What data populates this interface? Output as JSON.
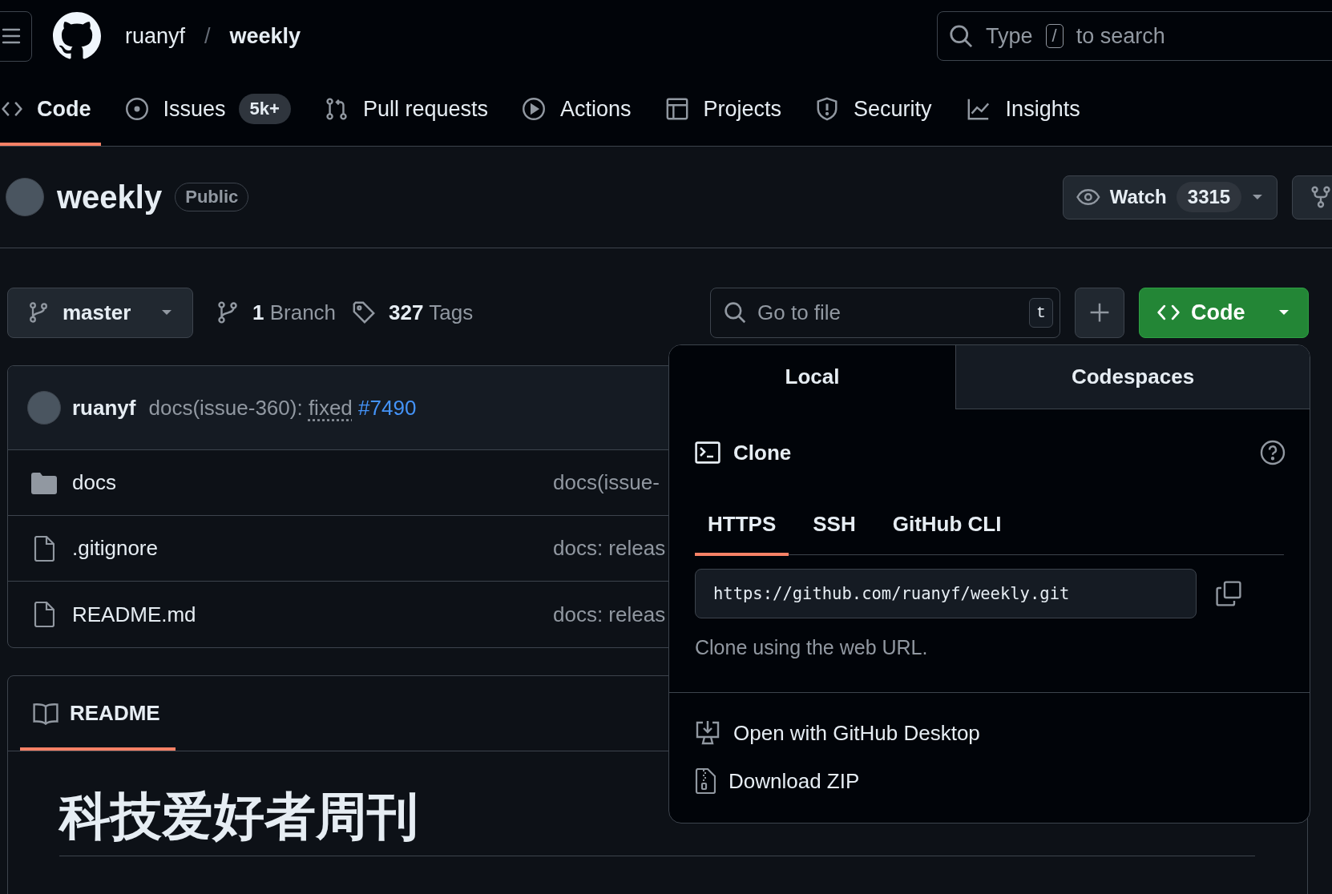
{
  "header": {
    "owner": "ruanyf",
    "separator": "/",
    "repo": "weekly",
    "search": {
      "hint_before": "Type",
      "key": "/",
      "hint_after": "to search"
    }
  },
  "tabs": [
    {
      "label": "Code",
      "selected": true
    },
    {
      "label": "Issues",
      "counter": "5k+",
      "selected": false
    },
    {
      "label": "Pull requests",
      "selected": false
    },
    {
      "label": "Actions",
      "selected": false
    },
    {
      "label": "Projects",
      "selected": false
    },
    {
      "label": "Security",
      "selected": false
    },
    {
      "label": "Insights",
      "selected": false
    }
  ],
  "repo": {
    "name": "weekly",
    "visibility": "Public",
    "watch": {
      "label": "Watch",
      "count": "3315"
    }
  },
  "toolbar": {
    "branch": "master",
    "branches": {
      "count": "1",
      "label": "Branch"
    },
    "tags": {
      "count": "327",
      "label": "Tags"
    },
    "file_search": {
      "placeholder": "Go to file",
      "key": "t"
    },
    "code_button": "Code"
  },
  "latest_commit": {
    "author": "ruanyf",
    "message": "docs(issue-360):",
    "link": "fixed",
    "issue": "#7490"
  },
  "files": [
    {
      "name": "docs",
      "kind": "folder",
      "commit": "docs(issue-"
    },
    {
      "name": ".gitignore",
      "kind": "file",
      "commit": "docs: releas"
    },
    {
      "name": "README.md",
      "kind": "file",
      "commit": "docs: releas"
    }
  ],
  "readme": {
    "tab": "README",
    "heading": "科技爱好者周刊"
  },
  "clone_popup": {
    "tabs": [
      {
        "label": "Local",
        "selected": true
      },
      {
        "label": "Codespaces",
        "selected": false
      }
    ],
    "title": "Clone",
    "protocols": [
      {
        "label": "HTTPS",
        "selected": true
      },
      {
        "label": "SSH",
        "selected": false
      },
      {
        "label": "GitHub CLI",
        "selected": false
      }
    ],
    "url": "https://github.com/ruanyf/weekly.git",
    "hint": "Clone using the web URL.",
    "actions": [
      {
        "label": "Open with GitHub Desktop"
      },
      {
        "label": "Download ZIP"
      }
    ]
  }
}
